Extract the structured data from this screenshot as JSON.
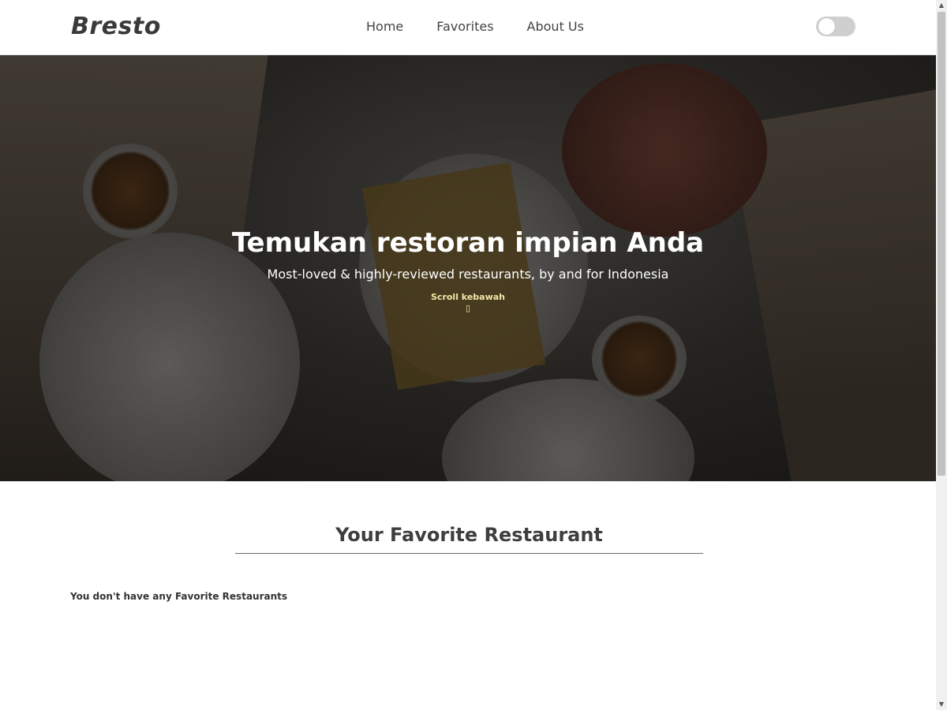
{
  "header": {
    "brand": "Bresto",
    "nav": [
      {
        "label": "Home"
      },
      {
        "label": "Favorites"
      },
      {
        "label": "About Us"
      }
    ],
    "theme_toggle": {
      "state": "off"
    }
  },
  "hero": {
    "title": "Temukan restoran impian Anda",
    "subtitle": "Most-loved & highly-reviewed restaurants, by and for Indonesia",
    "scroll_hint": "Scroll kebawah",
    "scroll_icon": "▯"
  },
  "main": {
    "section_title": "Your Favorite Restaurant",
    "empty_message": "You don't have any Favorite Restaurants"
  },
  "scrollbar": {
    "up_arrow": "▲",
    "down_arrow": "▼"
  }
}
